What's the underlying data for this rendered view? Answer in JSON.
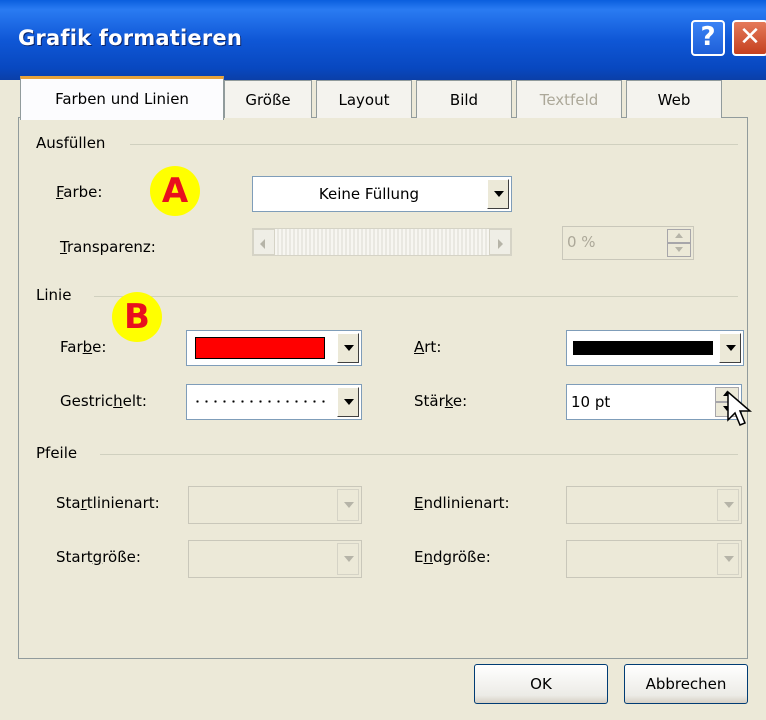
{
  "window": {
    "title": "Grafik formatieren",
    "help_glyph": "?",
    "close_glyph": "✕"
  },
  "tabs": [
    {
      "label": "Farben und Linien",
      "state": "active"
    },
    {
      "label": "Größe",
      "state": "normal"
    },
    {
      "label": "Layout",
      "state": "normal"
    },
    {
      "label": "Bild",
      "state": "normal"
    },
    {
      "label": "Textfeld",
      "state": "disabled"
    },
    {
      "label": "Web",
      "state": "normal"
    }
  ],
  "fill": {
    "group_label": "Ausfüllen",
    "color_label_pre": "",
    "color_label_u": "F",
    "color_label_post": "arbe:",
    "color_value": "Keine Füllung",
    "transparency_label_pre": "",
    "transparency_label_u": "T",
    "transparency_label_post": "ransparenz:",
    "transparency_value": "0 %"
  },
  "line": {
    "group_label": "Linie",
    "color_label_pre": "Far",
    "color_label_u": "b",
    "color_label_post": "e:",
    "color_value_hex": "#FF0000",
    "dash_label_pre": "Gestric",
    "dash_label_u": "h",
    "dash_label_post": "elt:",
    "style_label_pre": "",
    "style_label_u": "A",
    "style_label_post": "rt:",
    "weight_label_pre": "Stär",
    "weight_label_u": "k",
    "weight_label_post": "e:",
    "weight_value": "10 pt"
  },
  "arrows": {
    "group_label": "Pfeile",
    "begin_style_label_pre": "Sta",
    "begin_style_label_u": "r",
    "begin_style_label_post": "tlinienart:",
    "end_style_label_pre": "",
    "end_style_label_u": "E",
    "end_style_label_post": "ndlinienart:",
    "begin_size_label_pre": "Start",
    "begin_size_label_u": "g",
    "begin_size_label_post": "röße:",
    "end_size_label_pre": "E",
    "end_size_label_u": "n",
    "end_size_label_post": "dgröße:"
  },
  "annotations": {
    "a": "A",
    "b": "B"
  },
  "buttons": {
    "ok": "OK",
    "cancel": "Abbrechen"
  },
  "colors": {
    "titlebar": "#0A5FDE",
    "dialog": "#ECE9D8",
    "line_color": "#FF0000",
    "badge": "#FFFF00",
    "badge_text": "#E8101E"
  }
}
